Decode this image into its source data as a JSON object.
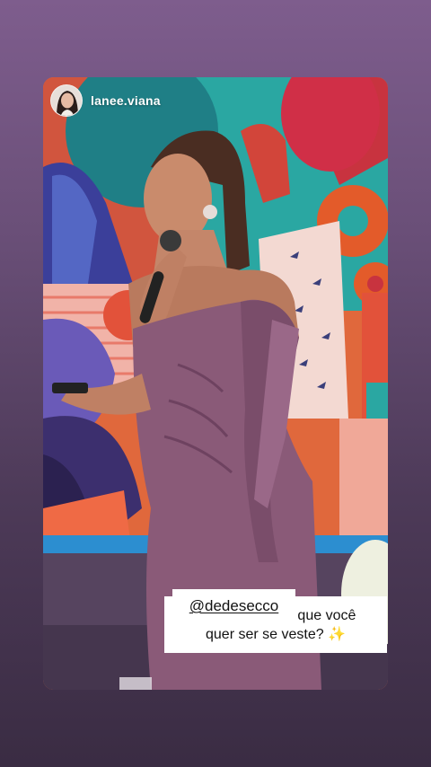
{
  "story": {
    "username": "lanee.viana",
    "avatar_icon": "profile-avatar",
    "caption_line1": "Como a mulher que você",
    "caption_line2": "quer ser se veste?",
    "caption_emoji": "✨",
    "mention": "@dedesecco"
  },
  "colors": {
    "background_top": "#7e5d8d",
    "background_bottom": "#3a2c43",
    "dress": "#8a5a78",
    "mural_orange": "#e0683c",
    "mural_teal": "#2aa7a2",
    "mural_red": "#c8333f"
  }
}
